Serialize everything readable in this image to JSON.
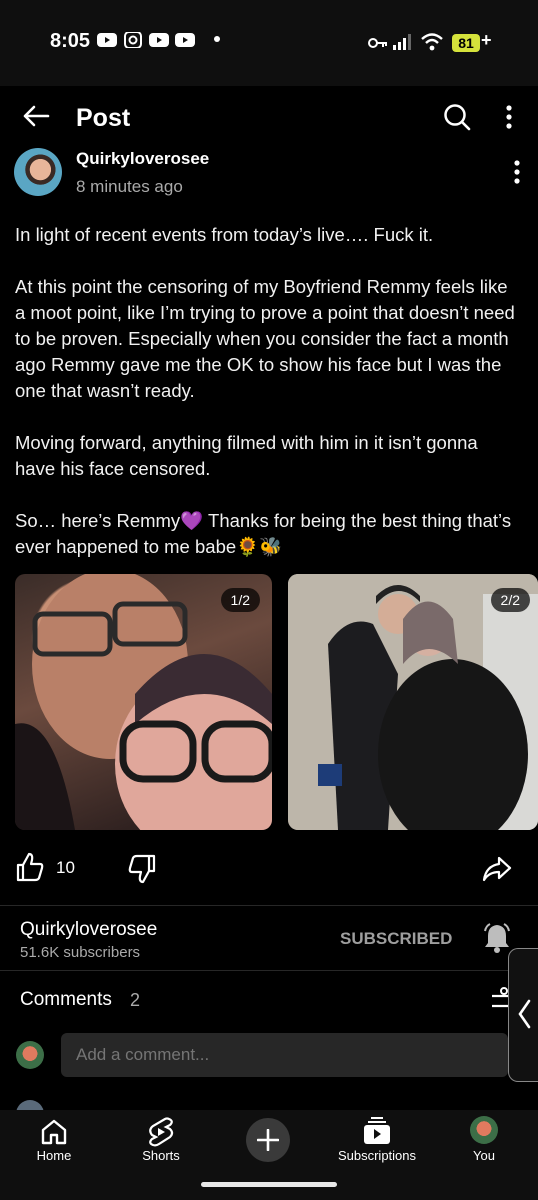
{
  "status_bar": {
    "time": "8:05",
    "battery": "81",
    "battery_suffix": "+"
  },
  "header": {
    "title": "Post"
  },
  "post": {
    "author": "Quirkyloverosee",
    "time": "8 minutes ago",
    "paragraphs": [
      "In light of recent events from today’s live…. Fuck it.",
      "At this point the censoring of my Boyfriend Remmy feels like a moot point, like I’m trying to prove a point that doesn’t need to be proven. Especially when you consider the fact a month ago Remmy gave me the OK to show his face but I was the one that wasn’t ready.",
      "Moving forward, anything filmed with him in it isn’t gonna have his face censored.",
      "So… here’s Remmy💜 Thanks for being the best thing that’s ever happened to me babe🌻🐝"
    ],
    "images": [
      {
        "counter": "1/2"
      },
      {
        "counter": "2/2"
      }
    ],
    "like_count": "10"
  },
  "channel": {
    "name": "Quirkyloverosee",
    "subscribers": "51.6K subscribers",
    "subscribe_label": "SUBSCRIBED"
  },
  "comments": {
    "title": "Comments",
    "count": "2",
    "placeholder": "Add a comment..."
  },
  "nav": {
    "home": "Home",
    "shorts": "Shorts",
    "subscriptions": "Subscriptions",
    "you": "You"
  },
  "colors": {
    "background": "#000000",
    "surface": "#272727",
    "battery": "#d5e23b",
    "secondary_text": "#aaaaaa"
  }
}
